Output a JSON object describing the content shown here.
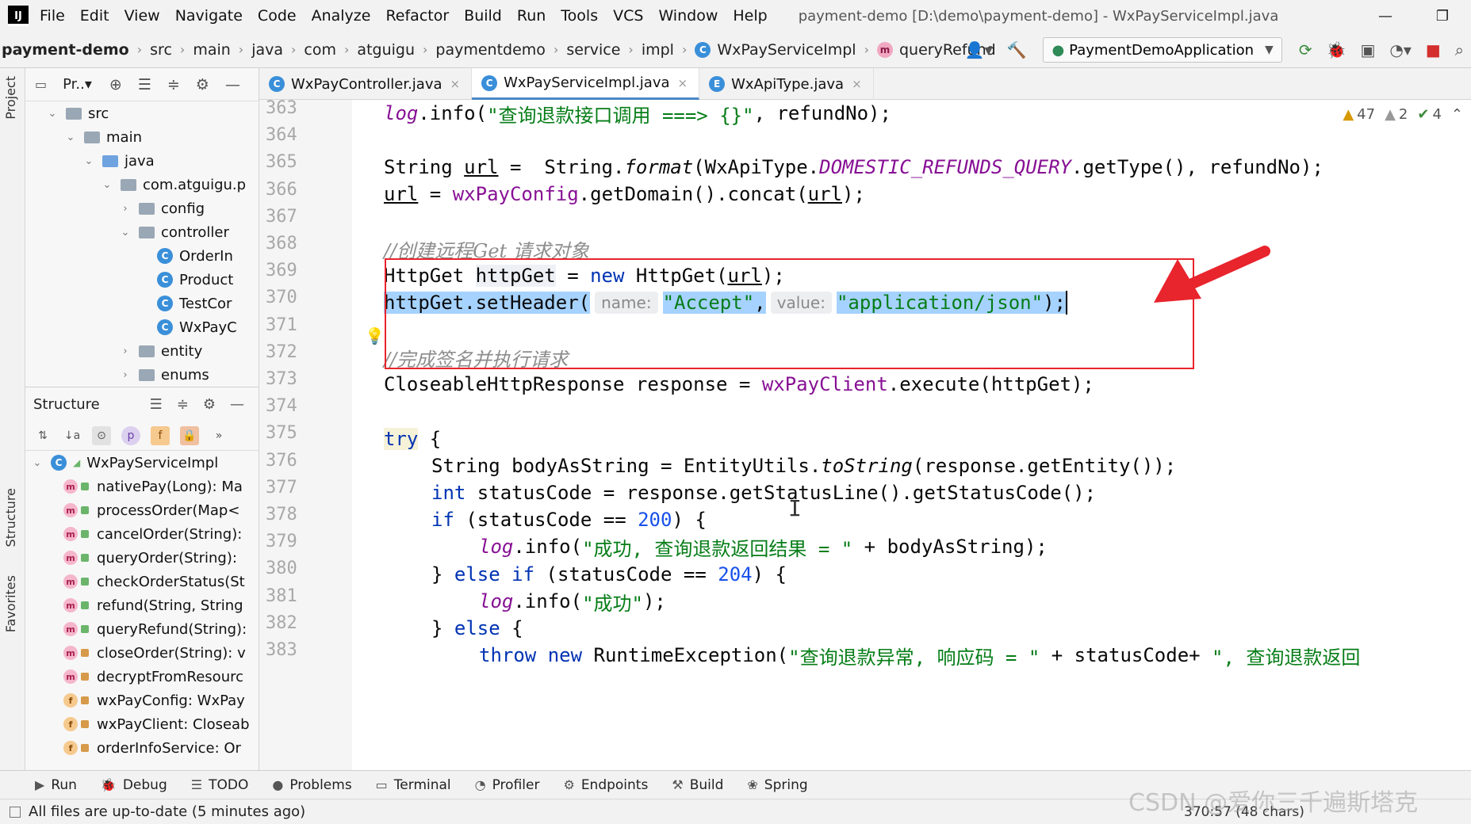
{
  "menubar": {
    "items": [
      "File",
      "Edit",
      "View",
      "Navigate",
      "Code",
      "Analyze",
      "Refactor",
      "Build",
      "Run",
      "Tools",
      "VCS",
      "Window",
      "Help"
    ],
    "window_title": "payment-demo [D:\\demo\\payment-demo] - WxPayServiceImpl.java",
    "minimize": "—",
    "restore": "❐"
  },
  "breadcrumbs": [
    "payment-demo",
    "src",
    "main",
    "java",
    "com",
    "atguigu",
    "paymentdemo",
    "service",
    "impl",
    "WxPayServiceImpl",
    "queryRefund"
  ],
  "run_config": "PaymentDemoApplication",
  "project_panel": {
    "title": "Pr..▾",
    "tree": [
      {
        "label": "src",
        "indent": 1,
        "toggle": "⌄",
        "type": "folder"
      },
      {
        "label": "main",
        "indent": 2,
        "toggle": "⌄",
        "type": "folder"
      },
      {
        "label": "java",
        "indent": 3,
        "toggle": "⌄",
        "type": "folder-blue"
      },
      {
        "label": "com.atguigu.p",
        "indent": 4,
        "toggle": "⌄",
        "type": "folder"
      },
      {
        "label": "config",
        "indent": 5,
        "toggle": "›",
        "type": "folder"
      },
      {
        "label": "controller",
        "indent": 5,
        "toggle": "⌄",
        "type": "folder"
      },
      {
        "label": "OrderIn",
        "indent": 6,
        "toggle": "",
        "type": "class"
      },
      {
        "label": "Product",
        "indent": 6,
        "toggle": "",
        "type": "class"
      },
      {
        "label": "TestCor",
        "indent": 6,
        "toggle": "",
        "type": "class"
      },
      {
        "label": "WxPayC",
        "indent": 6,
        "toggle": "",
        "type": "class"
      },
      {
        "label": "entity",
        "indent": 5,
        "toggle": "›",
        "type": "folder"
      },
      {
        "label": "enums",
        "indent": 5,
        "toggle": "›",
        "type": "folder"
      }
    ]
  },
  "structure_panel": {
    "title": "Structure",
    "root": "WxPayServiceImpl",
    "members": [
      {
        "kind": "m",
        "vis": "pub",
        "label": "nativePay(Long): Ma"
      },
      {
        "kind": "m",
        "vis": "pub",
        "label": "processOrder(Map<"
      },
      {
        "kind": "m",
        "vis": "pub",
        "label": "cancelOrder(String):"
      },
      {
        "kind": "m",
        "vis": "pub",
        "label": "queryOrder(String):"
      },
      {
        "kind": "m",
        "vis": "pub",
        "label": "checkOrderStatus(St"
      },
      {
        "kind": "m",
        "vis": "pub",
        "label": "refund(String, String"
      },
      {
        "kind": "m",
        "vis": "pub",
        "label": "queryRefund(String):"
      },
      {
        "kind": "m",
        "vis": "priv",
        "label": "closeOrder(String): v"
      },
      {
        "kind": "m",
        "vis": "priv",
        "label": "decryptFromResourc"
      },
      {
        "kind": "f",
        "vis": "priv",
        "label": "wxPayConfig: WxPay"
      },
      {
        "kind": "f",
        "vis": "priv",
        "label": "wxPayClient: Closeab"
      },
      {
        "kind": "f",
        "vis": "priv",
        "label": "orderInfoService: Or"
      }
    ]
  },
  "editor_tabs": [
    {
      "label": "WxPayController.java",
      "active": false,
      "icon": "C"
    },
    {
      "label": "WxPayServiceImpl.java",
      "active": true,
      "icon": "C"
    },
    {
      "label": "WxApiType.java",
      "active": false,
      "icon": "E"
    }
  ],
  "inspections": {
    "warnings": "47",
    "weak": "2",
    "ok": "4"
  },
  "line_numbers": [
    "363",
    "364",
    "365",
    "366",
    "367",
    "368",
    "369",
    "370",
    "371",
    "372",
    "373",
    "374",
    "375",
    "376",
    "377",
    "378",
    "379",
    "380",
    "381",
    "382",
    "383"
  ],
  "code": {
    "l363_a": "log",
    "l363_b": ".info(",
    "l363_c": "\"查询退款接口调用 ===> {}\"",
    "l363_d": ", refundNo);",
    "l365_a": "String ",
    "l365_b": "url",
    "l365_c": " =  String.",
    "l365_d": "format",
    "l365_e": "(WxApiType.",
    "l365_f": "DOMESTIC_REFUNDS_QUERY",
    "l365_g": ".getType(), refundNo);",
    "l366_a": "url",
    "l366_b": " = ",
    "l366_c": "wxPayConfig",
    "l366_d": ".getDomain().concat(",
    "l366_e": "url",
    "l366_f": ");",
    "l368": "//创建远程Get 请求对象",
    "l369_a": "HttpGet ",
    "l369_b": "httpGet",
    "l369_c": " = ",
    "l369_d": "new",
    "l369_e": " HttpGet(",
    "l369_f": "url",
    "l369_g": ");",
    "l370_a": "httpGet.setHeader(",
    "l370_hint1": "name:",
    "l370_b": "\"Accept\"",
    "l370_c": ",",
    "l370_hint2": "value:",
    "l370_d": "\"application/json\"",
    "l370_e": ");",
    "l372": "//完成签名并执行请求",
    "l373_a": "CloseableHttpResponse response = ",
    "l373_b": "wxPayClient",
    "l373_c": ".execute(httpGet);",
    "l375_a": "try",
    "l375_b": " {",
    "l376_a": "String bodyAsString = EntityUtils.",
    "l376_b": "toString",
    "l376_c": "(response.getEntity());",
    "l377_a": "int",
    "l377_b": " statusCode = response.getStatusLine().getStatusCode();",
    "l378_a": "if",
    "l378_b": " (statusCode == ",
    "l378_c": "200",
    "l378_d": ") {",
    "l379_a": "log",
    "l379_b": ".info(",
    "l379_c": "\"成功, 查询退款返回结果 = \"",
    "l379_d": " + bodyAsString);",
    "l380_a": "} ",
    "l380_b": "else if",
    "l380_c": " (statusCode == ",
    "l380_d": "204",
    "l380_e": ") {",
    "l381_a": "log",
    "l381_b": ".info(",
    "l381_c": "\"成功\"",
    "l381_d": ");",
    "l382_a": "} ",
    "l382_b": "else",
    "l382_c": " {",
    "l383_a": "throw new",
    "l383_b": " RuntimeException(",
    "l383_c": "\"查询退款异常, 响应码 = \"",
    "l383_d": " + statusCode+ ",
    "l383_e": "\", 查询退款返回"
  },
  "bottom_tools": [
    "Run",
    "Debug",
    "TODO",
    "Problems",
    "Terminal",
    "Profiler",
    "Endpoints",
    "Build",
    "Spring"
  ],
  "status": {
    "message": "All files are up-to-date (5 minutes ago)",
    "position": "370:57 (48 chars)"
  },
  "left_strip": {
    "project": "Project",
    "structure": "Structure",
    "favorites": "Favorites"
  },
  "watermark": "CSDN @爱你三千遍斯塔克",
  "colors": {
    "accent": "#4a88c7",
    "highlight_box": "#e8242c",
    "selection": "#a6d2ff"
  }
}
